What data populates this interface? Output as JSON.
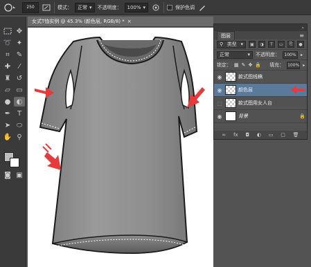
{
  "options_bar": {
    "brush_size": "250",
    "mode_label": "模式：",
    "mode_value": "正常",
    "opacity_label": "不透明度：",
    "opacity_value": "100%",
    "flow_label": "流量：",
    "flow_value": "100%",
    "protect_label": "保护色调"
  },
  "document": {
    "tab_title": "女式T恤实例 @ 45.3% (颜色层, RGB/8) *"
  },
  "layers_panel": {
    "title": "图层",
    "collapse_icon": "»",
    "menu_icon": "≡",
    "filter_label": "类型",
    "blend_mode": "正常",
    "opacity_label": "不透明度：",
    "opacity_value": "100%",
    "lock_label": "锁定：",
    "fill_label": "填充：",
    "fill_value": "100%",
    "layers": [
      {
        "name": "款式图线稿"
      },
      {
        "name": "颜色层"
      },
      {
        "name": "款式图用女人台"
      },
      {
        "name": "背景"
      }
    ],
    "footer_icons": [
      "link-icon",
      "fx-icon",
      "mask-icon",
      "adjustment-icon",
      "group-icon",
      "new-layer-icon",
      "delete-icon"
    ]
  },
  "colors": {
    "foreground": "#bdbdbd",
    "background": "#ffffff",
    "shirt_fill": "#8f8f8f",
    "arrow": "#e83a3a",
    "selected_layer": "#5a7a9c"
  }
}
